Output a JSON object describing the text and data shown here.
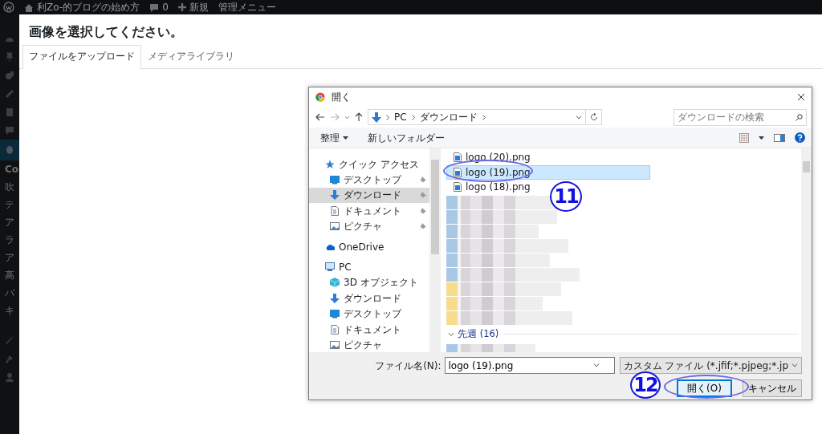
{
  "admin_bar": {
    "site_name": "利Zo-的ブログの始め方",
    "comments": "0",
    "new": "新規",
    "admin_menu": "管理メニュー"
  },
  "sidebar": {
    "submenu": [
      {
        "label": "Co"
      },
      {
        "label": "吹"
      },
      {
        "label": "テ"
      },
      {
        "label": "ア"
      },
      {
        "label": "ラ"
      },
      {
        "label": "ア"
      },
      {
        "label": "高"
      },
      {
        "label": "バ"
      },
      {
        "label": "キ"
      }
    ]
  },
  "modal": {
    "title": "画像を選択してください。",
    "tabs": [
      {
        "label": "ファイルをアップロード",
        "selected": true
      },
      {
        "label": "メディアライブラリ",
        "selected": false
      }
    ]
  },
  "dialog": {
    "title": "開く",
    "path": [
      "PC",
      "ダウンロード"
    ],
    "search": {
      "placeholder": "ダウンロードの検索"
    },
    "toolbar": {
      "organize": "整理",
      "new_folder": "新しいフォルダー"
    },
    "nav": [
      {
        "label": "クイック アクセス",
        "kind": "star",
        "selected": false,
        "children": [
          {
            "label": "デスクトップ",
            "kind": "desktop",
            "pinned": true,
            "selected": false
          },
          {
            "label": "ダウンロード",
            "kind": "downloads",
            "pinned": true,
            "selected": true
          },
          {
            "label": "ドキュメント",
            "kind": "documents",
            "pinned": true,
            "selected": false
          },
          {
            "label": "ピクチャ",
            "kind": "pictures",
            "pinned": true,
            "selected": false
          }
        ]
      },
      {
        "label": "OneDrive",
        "kind": "cloud",
        "selected": false
      },
      {
        "label": "PC",
        "kind": "pc",
        "selected": false,
        "children": [
          {
            "label": "3D オブジェクト",
            "kind": "cube",
            "pinned": false,
            "selected": false
          },
          {
            "label": "ダウンロード",
            "kind": "downloads",
            "pinned": false,
            "selected": false
          },
          {
            "label": "デスクトップ",
            "kind": "desktop",
            "pinned": false,
            "selected": false
          },
          {
            "label": "ドキュメント",
            "kind": "documents",
            "pinned": false,
            "selected": false
          },
          {
            "label": "ピクチャ",
            "kind": "pictures",
            "pinned": false,
            "selected": false
          }
        ]
      }
    ],
    "files": [
      {
        "kind": "file",
        "name": "logo (20).png",
        "selected": false
      },
      {
        "kind": "file",
        "name": "logo (19).png",
        "selected": true
      },
      {
        "kind": "file",
        "name": "logo (18).png",
        "selected": false
      },
      {
        "kind": "blurred_image"
      },
      {
        "kind": "blurred_image"
      },
      {
        "kind": "blurred_image"
      },
      {
        "kind": "blurred_image"
      },
      {
        "kind": "blurred_image"
      },
      {
        "kind": "blurred_image"
      },
      {
        "kind": "blurred_folder"
      },
      {
        "kind": "blurred_folder"
      },
      {
        "kind": "blurred_folder"
      },
      {
        "kind": "group",
        "label": "先週 (16)",
        "expanded": true
      },
      {
        "kind": "blurred_image"
      }
    ],
    "filename": {
      "label": "ファイル名(N):",
      "value": "logo (19).png"
    },
    "filter": "カスタム ファイル (*.jfif;*.pjpeg;*.jp",
    "buttons": [
      {
        "label": "開く(O)",
        "kind": "default"
      },
      {
        "label": "キャンセル",
        "kind": "normal"
      }
    ]
  },
  "annotations": [
    {
      "label": "11"
    },
    {
      "label": "12"
    }
  ]
}
